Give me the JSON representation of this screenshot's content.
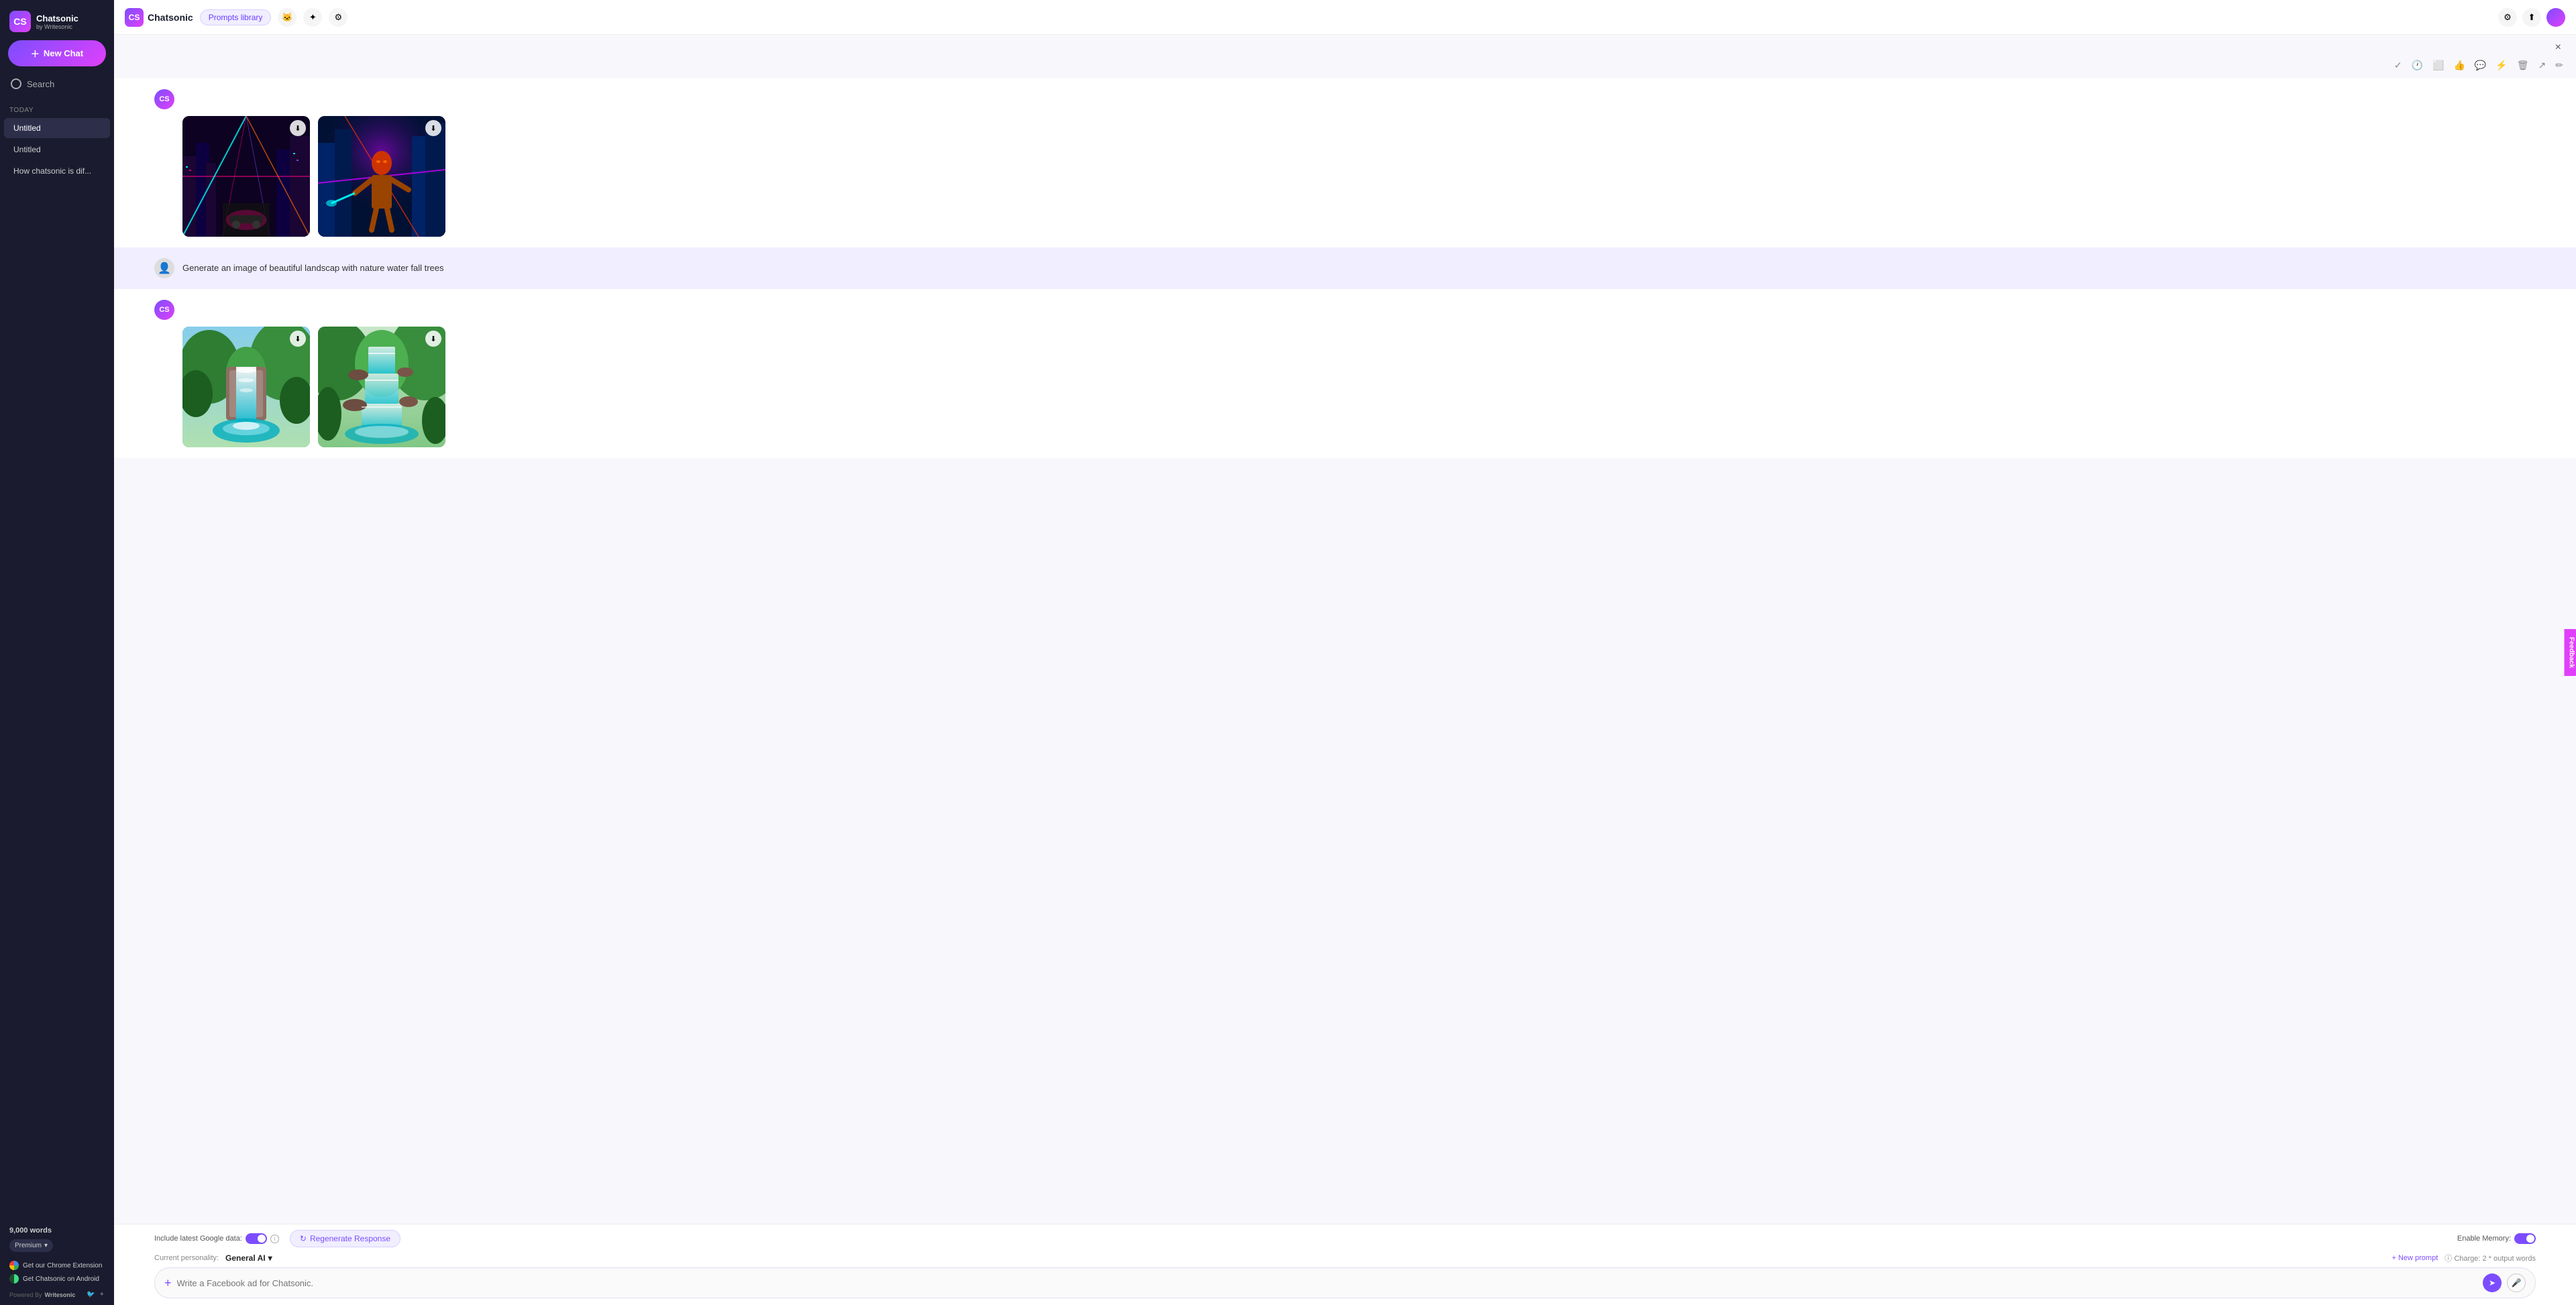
{
  "app": {
    "name": "Chatsonic",
    "subtitle": "by Writesonic",
    "logo_initials": "CS"
  },
  "sidebar": {
    "new_chat_label": "New Chat",
    "search_label": "Search",
    "today_label": "TODAY",
    "items": [
      {
        "label": "Untitled",
        "active": true
      },
      {
        "label": "Untitled",
        "active": false
      },
      {
        "label": "How chatsonic is dif...",
        "active": false
      }
    ],
    "words_count": "9,000 words",
    "premium_label": "Premium",
    "chrome_ext_label": "Get our Chrome Extension",
    "android_label": "Get Chatsonic on Android",
    "powered_by": "Powered By",
    "writesonic_label": "Writesonic"
  },
  "topbar": {
    "logo_initials": "CS",
    "app_name": "Chatsonic",
    "prompts_library": "Prompts library"
  },
  "chat": {
    "action_bar": {
      "close": "×"
    },
    "messages": [
      {
        "type": "user",
        "prompt": "Generate an image of beautiful landscap with nature water fall trees"
      }
    ],
    "images": {
      "cyberpunk": {
        "label": "Cyberpunk city images",
        "download_title": "Download"
      },
      "waterfall": {
        "label": "Waterfall landscape images",
        "download_title": "Download"
      }
    }
  },
  "bottom": {
    "google_data_label": "Include latest Google data:",
    "regen_label": "Regenerate Response",
    "memory_label": "Enable Memory:",
    "personality_label": "Current personality:",
    "personality_value": "General AI",
    "new_prompt_label": "+ New prompt",
    "charge_label": "Charge: 2 * output words",
    "input_placeholder": "Write a Facebook ad for Chatsonic.",
    "plus_symbol": "+",
    "send_symbol": "➤",
    "mic_symbol": "🎤"
  },
  "feedback": {
    "label": "Feedback"
  }
}
